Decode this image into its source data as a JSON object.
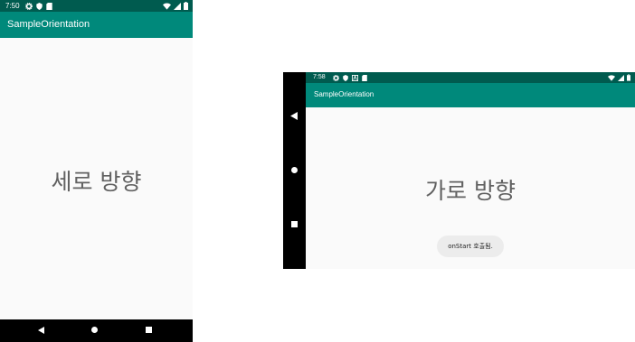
{
  "portrait": {
    "status_bar": {
      "time": "7:50",
      "left_icons": [
        "gear-icon",
        "shield-icon",
        "sd-card-icon"
      ],
      "right_icons": [
        "wifi-icon",
        "signal-icon",
        "battery-icon"
      ]
    },
    "app_bar": {
      "title": "SampleOrientation"
    },
    "content": {
      "main_text": "세로 방향"
    },
    "nav_bar": {
      "buttons": [
        "back-icon",
        "home-icon",
        "recents-icon"
      ]
    }
  },
  "landscape": {
    "status_bar": {
      "time": "7:58",
      "left_icons": [
        "gear-icon",
        "shield-icon",
        "a-box-icon",
        "sd-card-icon"
      ],
      "right_icons": [
        "wifi-icon",
        "signal-icon",
        "battery-icon"
      ]
    },
    "app_bar": {
      "title": "SampleOrientation"
    },
    "content": {
      "main_text": "가로 방향"
    },
    "toast": {
      "text": "onStart 호출됨."
    },
    "nav_bar": {
      "buttons": [
        "back-icon",
        "home-icon",
        "recents-icon"
      ]
    }
  },
  "colors": {
    "status_bar": "#005b4f",
    "app_bar": "#00897b",
    "background": "#fafafa",
    "main_text": "#616161",
    "nav_bar": "#000000",
    "toast_bg": "#ececec"
  }
}
